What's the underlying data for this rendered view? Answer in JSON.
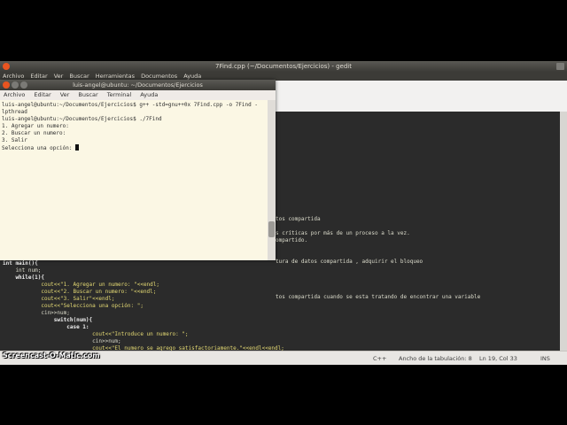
{
  "gedit": {
    "title": "7Find.cpp (~/Documentos/Ejercicios) - gedit",
    "menu": [
      "Archivo",
      "Editar",
      "Ver",
      "Buscar",
      "Herramientas",
      "Documentos",
      "Ayuda"
    ],
    "background_text": [
      "tos compartida",
      "s críticas por más de un proceso a la vez.",
      "ompartido.",
      "tura de datos compartida , adquirir el bloqueo",
      "tos compartida cuando se esta tratando de encontrar una variable"
    ],
    "code_lines": [
      "int main(){",
      "    int num;",
      "    while(1){",
      "            cout<<\"1. Agregar un numero: \"<<endl;",
      "            cout<<\"2. Buscar un numero: \"<<endl;",
      "            cout<<\"3. Salir\"<<endl;",
      "            cout<<\"Selecciona una opción: \";",
      "            cin>>num;",
      "                switch(num){",
      "                    case 1:",
      "                            cout<<\"Introduce un numero: \";",
      "                            cin>>num;",
      "                            cout<<\"El numero se agrego satisfactoriamente.\"<<endl<<endl;"
    ],
    "status": {
      "language": "C++",
      "tab_width": "Ancho de la tabulación: 8",
      "position": "Ln 19, Col 33",
      "mode": "INS"
    }
  },
  "terminal": {
    "title": "luis-angel@ubuntu: ~/Documentos/Ejercicios",
    "menu": [
      "Archivo",
      "Editar",
      "Ver",
      "Buscar",
      "Terminal",
      "Ayuda"
    ],
    "lines": [
      "luis-angel@ubuntu:~/Documentos/Ejercicios$ g++ -std=gnu++0x 7Find.cpp -o 7Find -",
      "lpthread",
      "luis-angel@ubuntu:~/Documentos/Ejercicios$ ./7Find",
      "1. Agregar un numero:",
      "2. Buscar un numero:",
      "3. Salir",
      "Selecciona una opción: "
    ]
  },
  "watermark": "Screencast-O-Matic.com",
  "colors": {
    "titlebar": "#3c3b37",
    "close_button": "#e95420",
    "editor_bg": "#2b2b2b",
    "terminal_bg": "#fbf7e4"
  }
}
